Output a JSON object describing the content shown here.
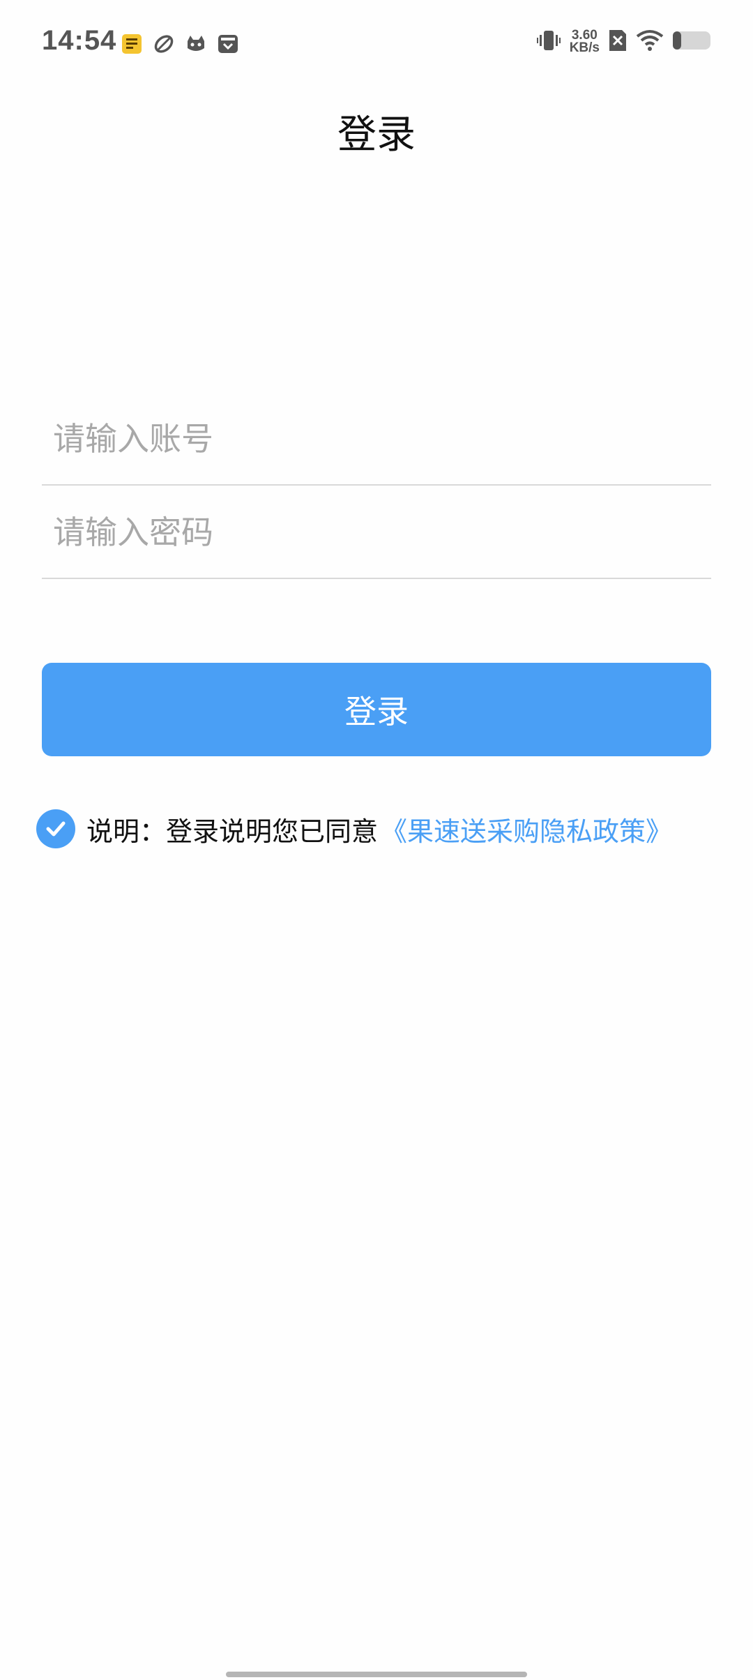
{
  "status_bar": {
    "time": "14:54",
    "net_speed_value": "3.60",
    "net_speed_unit": "KB/s",
    "left_icons": [
      "reading-app-icon",
      "leaf-app-icon",
      "cat-app-icon",
      "inbox-app-icon"
    ],
    "right_icons": [
      "vibrate-icon",
      "sim-off-icon",
      "wifi-icon",
      "battery-icon"
    ]
  },
  "header": {
    "title": "登录"
  },
  "form": {
    "account_placeholder": "请输入账号",
    "password_placeholder": "请输入密码",
    "account_value": "",
    "password_value": ""
  },
  "actions": {
    "login_label": "登录"
  },
  "agreement": {
    "checked": true,
    "text": "说明：登录说明您已同意",
    "link_text": "《果速送采购隐私政策》"
  },
  "colors": {
    "accent": "#4a9ff5",
    "title_text": "#111111",
    "placeholder": "#a8a8a8",
    "divider": "#d9d9d9"
  }
}
